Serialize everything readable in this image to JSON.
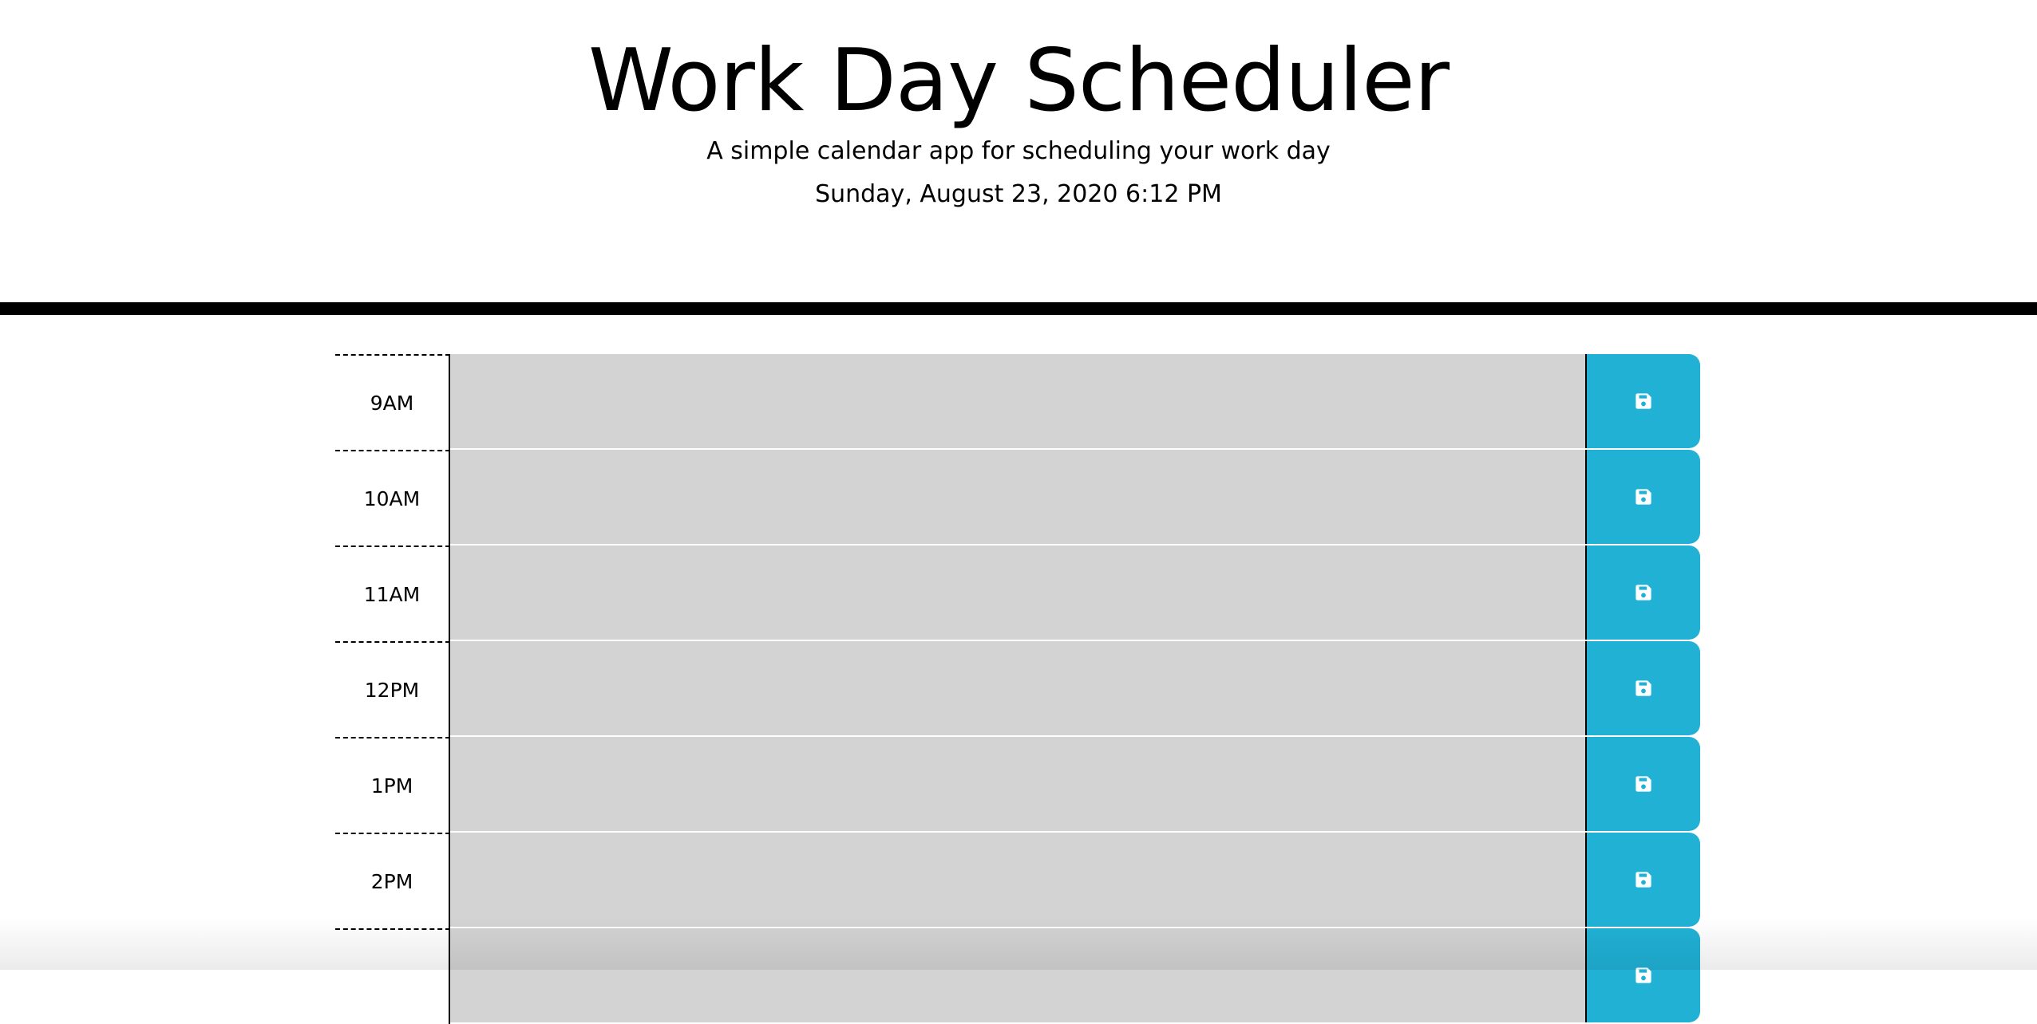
{
  "header": {
    "title": "Work Day Scheduler",
    "subtitle": "A simple calendar app for scheduling your work day",
    "current_day": "Sunday, August 23, 2020 6:12 PM"
  },
  "colors": {
    "past": "#d3d3d3",
    "save_button": "#20b1d5",
    "header_border": "#000000"
  },
  "timeblocks": [
    {
      "hour": "9AM",
      "description": "",
      "save_icon": "save-icon"
    },
    {
      "hour": "10AM",
      "description": "",
      "save_icon": "save-icon"
    },
    {
      "hour": "11AM",
      "description": "",
      "save_icon": "save-icon"
    },
    {
      "hour": "12PM",
      "description": "",
      "save_icon": "save-icon"
    },
    {
      "hour": "1PM",
      "description": "",
      "save_icon": "save-icon"
    },
    {
      "hour": "2PM",
      "description": "",
      "save_icon": "save-icon"
    },
    {
      "hour": "",
      "description": "",
      "save_icon": "save-icon"
    }
  ]
}
